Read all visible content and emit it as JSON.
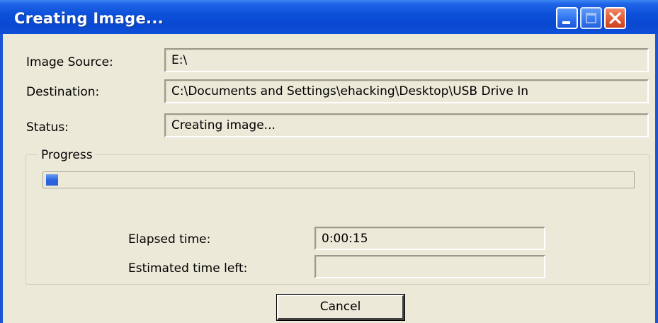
{
  "window": {
    "title": "Creating Image...",
    "title_bar_color": "#0a48d0",
    "body_color": "#ece9d8",
    "controls": [
      "minimize-icon",
      "maximize-icon",
      "close-icon"
    ]
  },
  "fields": {
    "image_source": {
      "label": "Image Source:",
      "value": "E:\\"
    },
    "destination": {
      "label": "Destination:",
      "value": "C:\\Documents and Settings\\ehacking\\Desktop\\USB Drive In"
    },
    "status": {
      "label": "Status:",
      "value": "Creating image..."
    }
  },
  "progress": {
    "group_label": "Progress",
    "fraction": 0.02,
    "bar_color": "#2d65e0",
    "elapsed_label": "Elapsed time:",
    "elapsed_value": "0:00:15",
    "estimated_label": "Estimated time left:",
    "estimated_value": ""
  },
  "buttons": {
    "cancel": "Cancel"
  }
}
